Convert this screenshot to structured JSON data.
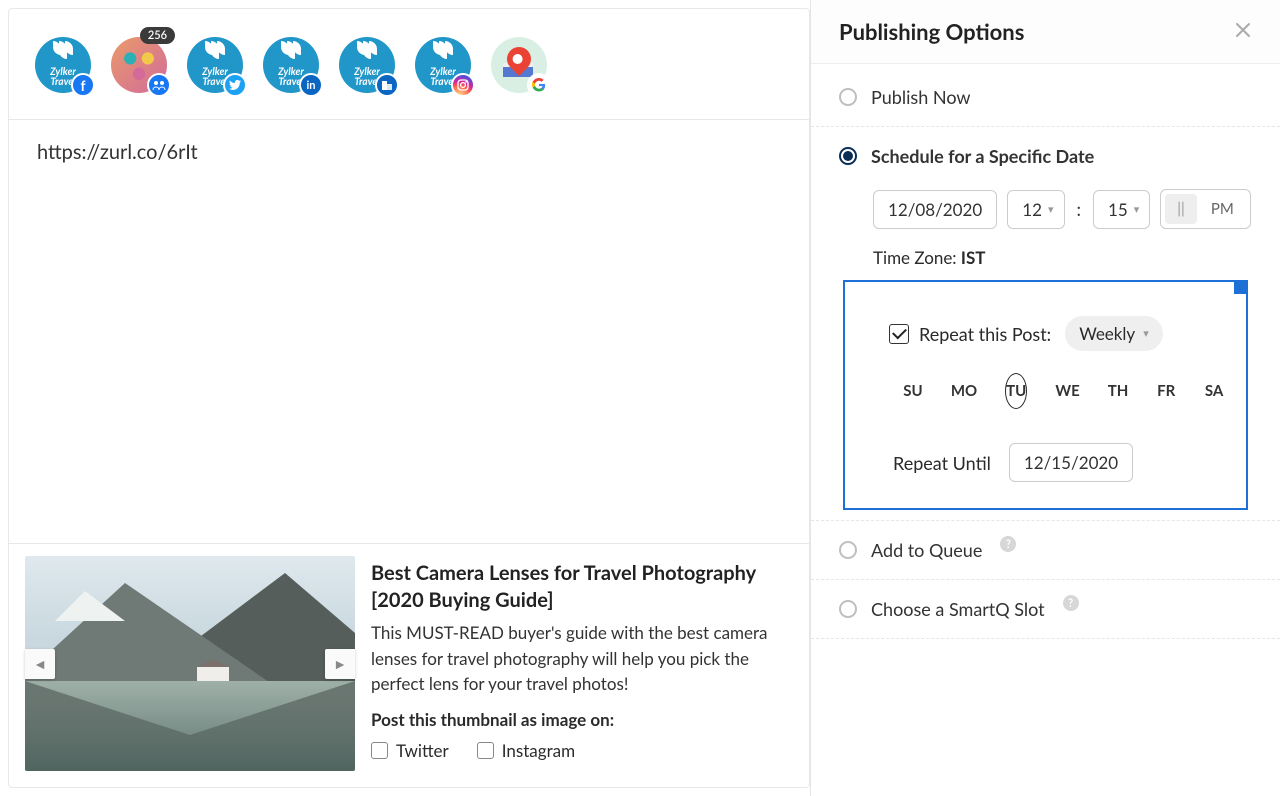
{
  "accounts": [
    {
      "id": "fb",
      "brand": "Zylker\nTravel",
      "network": "facebook"
    },
    {
      "id": "grp",
      "brand": "",
      "network": "fb-group",
      "count": "256"
    },
    {
      "id": "tw",
      "brand": "Zylker\nTravel",
      "network": "twitter"
    },
    {
      "id": "li",
      "brand": "Zylker\nTravel",
      "network": "linkedin"
    },
    {
      "id": "lic",
      "brand": "Zylker\nTravel",
      "network": "linkedin-company"
    },
    {
      "id": "ig",
      "brand": "Zylker\nTravel",
      "network": "instagram"
    },
    {
      "id": "gmb",
      "brand": "",
      "network": "google-my-business"
    }
  ],
  "compose": {
    "url": "https://zurl.co/6rIt"
  },
  "preview": {
    "title": "Best Camera Lenses for Travel Photography [2020 Buying Guide]",
    "description": "This MUST-READ buyer's guide with the best camera lenses for travel photography will help you pick the perfect lens for your travel photos!",
    "post_thumb_label": "Post this thumbnail as image on:",
    "thumb_opts": {
      "twitter": "Twitter",
      "instagram": "Instagram"
    }
  },
  "panel": {
    "title": "Publishing Options",
    "publish_now": "Publish Now",
    "schedule_label": "Schedule for a Specific Date",
    "schedule": {
      "date": "12/08/2020",
      "hour": "12",
      "minute": "15",
      "ampm": {
        "am": "||",
        "pm": "PM",
        "selected": "PM"
      },
      "tz_label": "Time Zone: ",
      "tz_value": "IST"
    },
    "repeat": {
      "label": "Repeat this Post:",
      "frequency": "Weekly",
      "days": [
        "SU",
        "MO",
        "TU",
        "WE",
        "TH",
        "FR",
        "SA"
      ],
      "selected_day": "TU",
      "until_label": "Repeat Until",
      "until_date": "12/15/2020"
    },
    "add_queue": "Add to Queue",
    "smartq": "Choose a SmartQ Slot"
  }
}
